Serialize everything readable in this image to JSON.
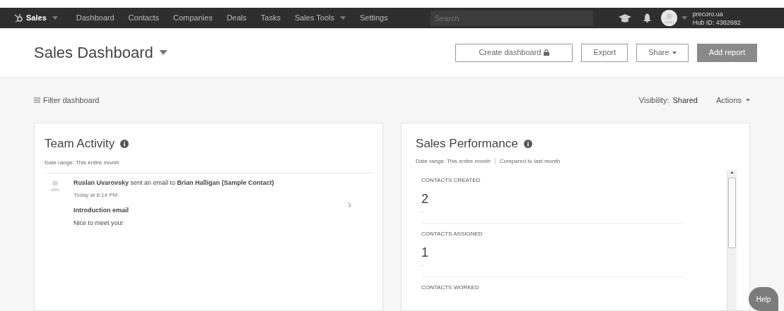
{
  "nav": {
    "brand": "Sales",
    "items": [
      {
        "label": "Dashboard",
        "has_menu": false
      },
      {
        "label": "Contacts",
        "has_menu": false
      },
      {
        "label": "Companies",
        "has_menu": false
      },
      {
        "label": "Deals",
        "has_menu": false
      },
      {
        "label": "Tasks",
        "has_menu": false
      },
      {
        "label": "Sales Tools",
        "has_menu": true
      },
      {
        "label": "Settings",
        "has_menu": false
      }
    ],
    "search": {
      "placeholder": "Search"
    },
    "account": {
      "name": "precoro.ua",
      "hub": "Hub ID: 4382682"
    }
  },
  "header": {
    "title": "Sales Dashboard",
    "buttons": [
      {
        "label": "Create dashboard",
        "kind": "locked"
      },
      {
        "label": "Export",
        "kind": "plain"
      },
      {
        "label": "Share",
        "kind": "menu"
      },
      {
        "label": "Add report",
        "kind": "primary"
      }
    ]
  },
  "filter_bar": {
    "filter": "Filter dashboard",
    "visibility_label": "Visibility:",
    "visibility": "Shared",
    "actions": "Actions"
  },
  "team_activity": {
    "title": "Team Activity",
    "date_range": "Date range: This entire month",
    "entries": [
      {
        "headline": "**Ruslan Uvarovsky** sent an email to **Brian Halligan (Sample Contact)**",
        "time": "Today at 8:14 PM",
        "subject": "Introduction email",
        "body": "Nice to meet you!"
      }
    ]
  },
  "sales_performance": {
    "title": "Sales Performance",
    "date_range": "Date range: This entire month",
    "comparison": "Compared to last month",
    "metrics": [
      {
        "label": "CONTACTS CREATED",
        "value": "2",
        "change": "-"
      },
      {
        "label": "CONTACTS ASSIGNED",
        "value": "1",
        "change": "-"
      },
      {
        "label": "CONTACTS WORKED"
      }
    ]
  },
  "help": "Help"
}
